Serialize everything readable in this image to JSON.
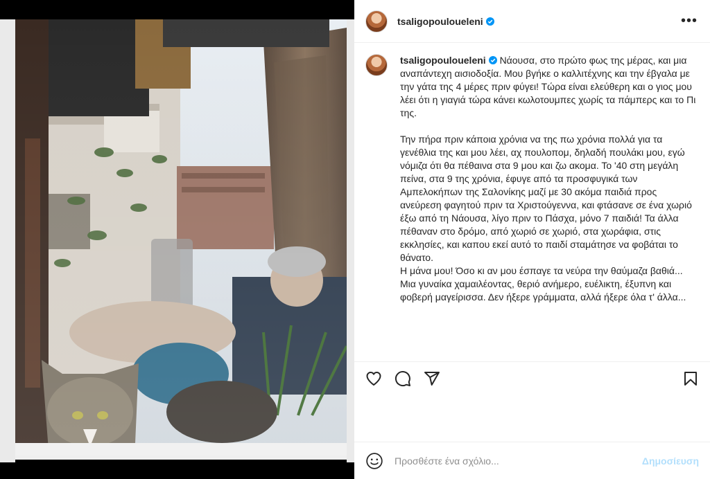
{
  "post": {
    "username": "tsaligopouloueleni",
    "verified": true,
    "caption_lines": [
      "Νάουσα, στο πρώτο φως της μέρας, και μια αναπάντεχη αισιοδοξία. Μου βγήκε ο καλλιτέχνης και την έβγαλα με την γάτα της 4 μέρες πριν φύγει! Τώρα είναι ελεύθερη και ο γιος μου λέει ότι η γιαγιά τώρα κάνει κωλοτουμπες χωρίς τα πάμπερς και το Πι της.",
      "Την πήρα πριν κάποια χρόνια να της πω χρόνια πολλά για τα γενέθλια της και μου λέει, αχ πουλοπομ, δηλαδή πουλάκι μου, εγώ νόμιζα ότι θα πέθαινα στα 9 μου και ζω ακομα. Το '40 στη μεγάλη πείνα, στα 9 της χρόνια, έφυγε από τα προσφυγικά των Αμπελοκήπων της Σαλονίκης μαζί με 30 ακόμα παιδιά προς ανεύρεση φαγητού πριν τα Χριστούγεννα, και φτάσανε σε ένα χωριό έξω από τη Νάουσα, λίγο πριν το Πάσχα, μόνο 7 παιδιά! Τα άλλα πέθαναν στο δρόμο, από χωριό σε χωριό, στα χωράφια, στις εκκλησίες, και καπου εκεί αυτό το παιδί σταμάτησε να φοβάται το θάνατο.",
      "Η μάνα μου! Όσο κι αν μου έσπαγε τα νεύρα την θαύμαζα βαθιά...",
      "Μια γυναίκα χαμαιλέοντας, θεριό ανήμερο, ευέλικτη, έξυπνη και φοβερή μαγείρισσα. Δεν ήξερε γράμματα, αλλά ήξερε όλα τ' άλλα..."
    ]
  },
  "comment": {
    "placeholder": "Προσθέστε ένα σχόλιο...",
    "post_label": "Δημοσίευση"
  },
  "icons": {
    "more": "more-options-icon",
    "like": "heart-icon",
    "comment": "comment-icon",
    "share": "share-icon",
    "save": "bookmark-icon",
    "emoji": "emoji-icon"
  },
  "colors": {
    "verified": "#0095f6",
    "post_button": "#b2dffc",
    "text": "#262626",
    "placeholder": "#8e8e8e"
  }
}
